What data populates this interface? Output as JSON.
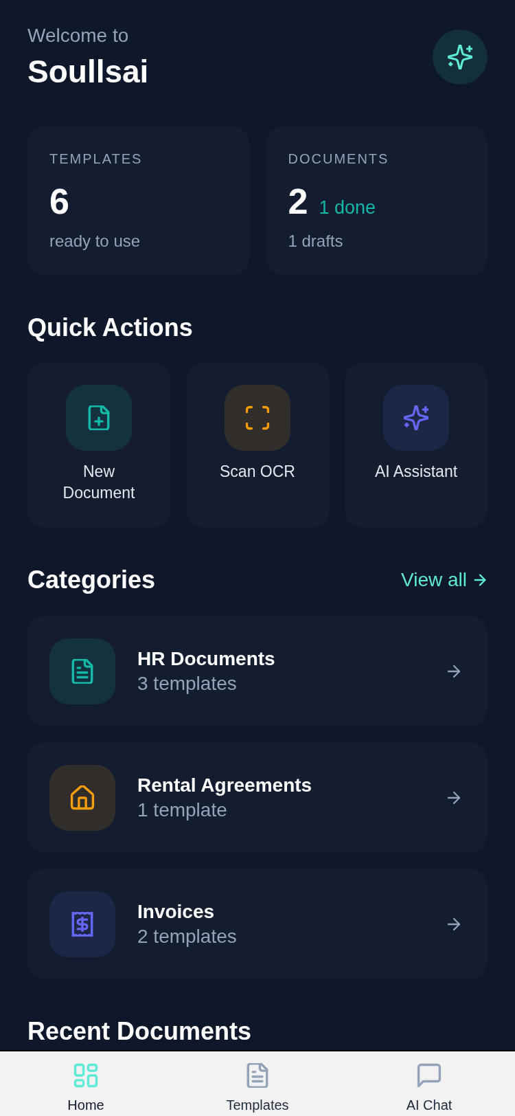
{
  "header": {
    "greeting": "Welcome to",
    "title": "Soullsai"
  },
  "stats": [
    {
      "label": "TEMPLATES",
      "value": "6",
      "caption": "ready to use"
    },
    {
      "label": "DOCUMENTS",
      "value": "2",
      "note": "1 done",
      "caption": "1 drafts"
    }
  ],
  "quick_actions": {
    "title": "Quick Actions",
    "items": [
      {
        "label": "New Document",
        "color": "#14b8a6"
      },
      {
        "label": "Scan OCR",
        "color": "#f59e0b"
      },
      {
        "label": "AI Assistant",
        "color": "#6366f1"
      }
    ]
  },
  "categories": {
    "title": "Categories",
    "link": "View all",
    "items": [
      {
        "name": "HR Documents",
        "count": "3 templates",
        "color": "#14b8a6"
      },
      {
        "name": "Rental Agreements",
        "count": "1 template",
        "color": "#f59e0b"
      },
      {
        "name": "Invoices",
        "count": "2 templates",
        "color": "#6366f1"
      }
    ]
  },
  "recent_documents": {
    "title": "Recent Documents"
  },
  "nav": [
    {
      "label": "Home",
      "selected": true
    },
    {
      "label": "Templates",
      "selected": false
    },
    {
      "label": "AI Chat",
      "selected": false
    }
  ]
}
